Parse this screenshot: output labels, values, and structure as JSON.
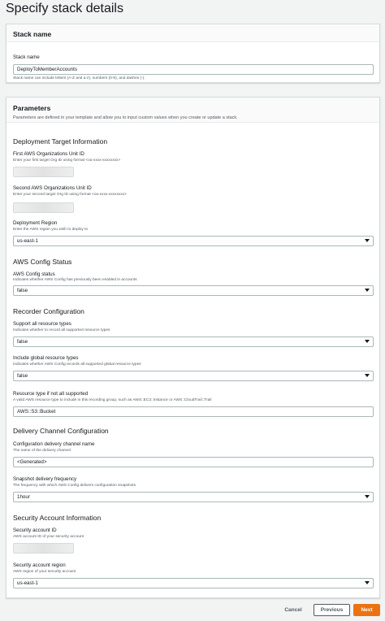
{
  "page": {
    "title": "Specify stack details"
  },
  "stack_name_panel": {
    "heading": "Stack name",
    "label": "Stack name",
    "value": "DeployToMemberAccounts",
    "description": "Stack name can include letters (A-Z and a-z), numbers (0-9), and dashes (-)."
  },
  "parameters_panel": {
    "heading": "Parameters",
    "description": "Parameters are defined in your template and allow you to input custom values when you create or update a stack.",
    "deployment_target": {
      "title": "Deployment Target Information",
      "first_ou": {
        "label": "First AWS Organizations Unit ID",
        "description": "Enter your first target Org ID using format <ou-xxxx-xxxxxxxx>"
      },
      "second_ou": {
        "label": "Second AWS Organizations Unit ID",
        "description": "Enter your second target Org ID using format <ou-xxxx-xxxxxxxx>"
      },
      "region": {
        "label": "Deployment Region",
        "description": "Enter the AWS region you wish to deploy to",
        "value": "us-east-1"
      }
    },
    "config_status": {
      "title": "AWS Config Status",
      "status": {
        "label": "AWS Config status",
        "description": "Indicates whether AWS Config has previously been enabled in accounts",
        "value": "false"
      }
    },
    "recorder": {
      "title": "Recorder Configuration",
      "support_all": {
        "label": "Support all resource types",
        "description": "Indicates whether to record all supported resource types",
        "value": "false"
      },
      "include_global": {
        "label": "Include global resource types",
        "description": "Indicates whether AWS Config records all supported global resource types",
        "value": "false"
      },
      "resource_type": {
        "label": "Resource type if not all supported",
        "description": "A valid AWS resource type to include in this recording group, such as AWS::EC2::Instance or AWS::CloudTrail::Trail",
        "value": "AWS::S3::Bucket"
      }
    },
    "delivery": {
      "title": "Delivery Channel Configuration",
      "channel_name": {
        "label": "Configuration delivery channel name",
        "description": "The name of the delivery channel",
        "value": "<Generated>"
      },
      "snapshot_frequency": {
        "label": "Snapshot delivery frequency",
        "description": "The frequency with which AWS Config delivers configuration snapshots",
        "value": "1hour"
      }
    },
    "security": {
      "title": "Security Account Information",
      "account_id": {
        "label": "Security account ID",
        "description": "AWS account ID of your security account"
      },
      "account_region": {
        "label": "Security account region",
        "description": "AWS region of your security account",
        "value": "us-east-1"
      }
    }
  },
  "footer": {
    "cancel": "Cancel",
    "previous": "Previous",
    "next": "Next"
  },
  "colors": {
    "primary_button": "#ec7211",
    "border": "#aab7b8",
    "background": "#f2f3f3"
  }
}
